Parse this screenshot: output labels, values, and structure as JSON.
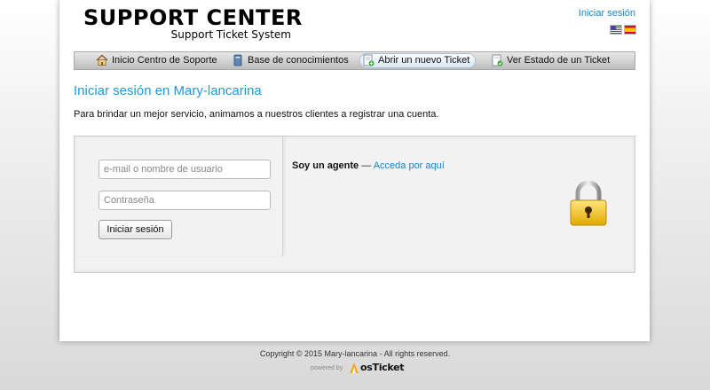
{
  "header": {
    "logo_title": "SUPPORT CENTER",
    "logo_subtitle": "Support Ticket System",
    "login_link": "Iniciar sesión",
    "flags": [
      "us-flag-icon",
      "es-flag-icon"
    ]
  },
  "nav": {
    "items": [
      {
        "label": "Inicio Centro de Soporte",
        "icon": "home-icon"
      },
      {
        "label": "Base de conocimientos",
        "icon": "book-icon"
      },
      {
        "label": "Abrir un nuevo Ticket",
        "icon": "new-ticket-icon",
        "active": true
      },
      {
        "label": "Ver Estado de un Ticket",
        "icon": "ticket-status-icon"
      }
    ]
  },
  "main": {
    "title": "Iniciar sesión en Mary-lancarina",
    "intro": "Para brindar un mejor servicio, animamos a nuestros clientes a registrar una cuenta.",
    "login": {
      "user_placeholder": "e-mail o nombre de usuario",
      "password_placeholder": "Contraseña",
      "submit_label": "Iniciar sesión"
    },
    "agent": {
      "label": "Soy un agente",
      "separator": " — ",
      "link": "Acceda por aquí"
    }
  },
  "footer": {
    "copyright": "Copyright © 2015 Mary-lancarina - All rights reserved.",
    "powered_by": "powered by",
    "brand": "osTicket"
  },
  "colors": {
    "accent": "#1d9ad6",
    "link": "#1a84c7",
    "lock": "#f2c21a"
  }
}
